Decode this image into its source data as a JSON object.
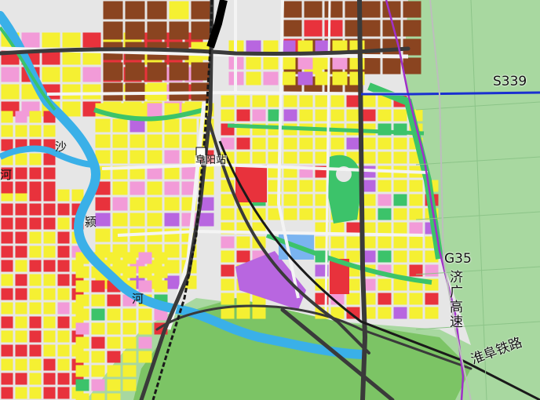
{
  "map": {
    "colors": {
      "rural": "#a8d8a0",
      "residential": "#f5f032",
      "commercial": "#e8323c",
      "industrial": "#8a4420",
      "public_service": "#f29bd8",
      "education": "#b866e0",
      "green_space": "#3cc36a",
      "water": "#3ab0e8",
      "road_fill": "#e6e6e6",
      "expressway": "#3a3a3a",
      "railway": "#1a1a1a",
      "provincial_road": "#1a2fd0",
      "boundary": "#a030c8",
      "parkland": "#7cc465"
    },
    "labels": {
      "s339": "S339",
      "g35": "G35",
      "g35_name": "济广高速",
      "railway": "淮阜铁路",
      "station": "阜阳站",
      "river_chars": [
        "沙",
        "颍",
        "河"
      ],
      "river_edge": "河"
    }
  }
}
